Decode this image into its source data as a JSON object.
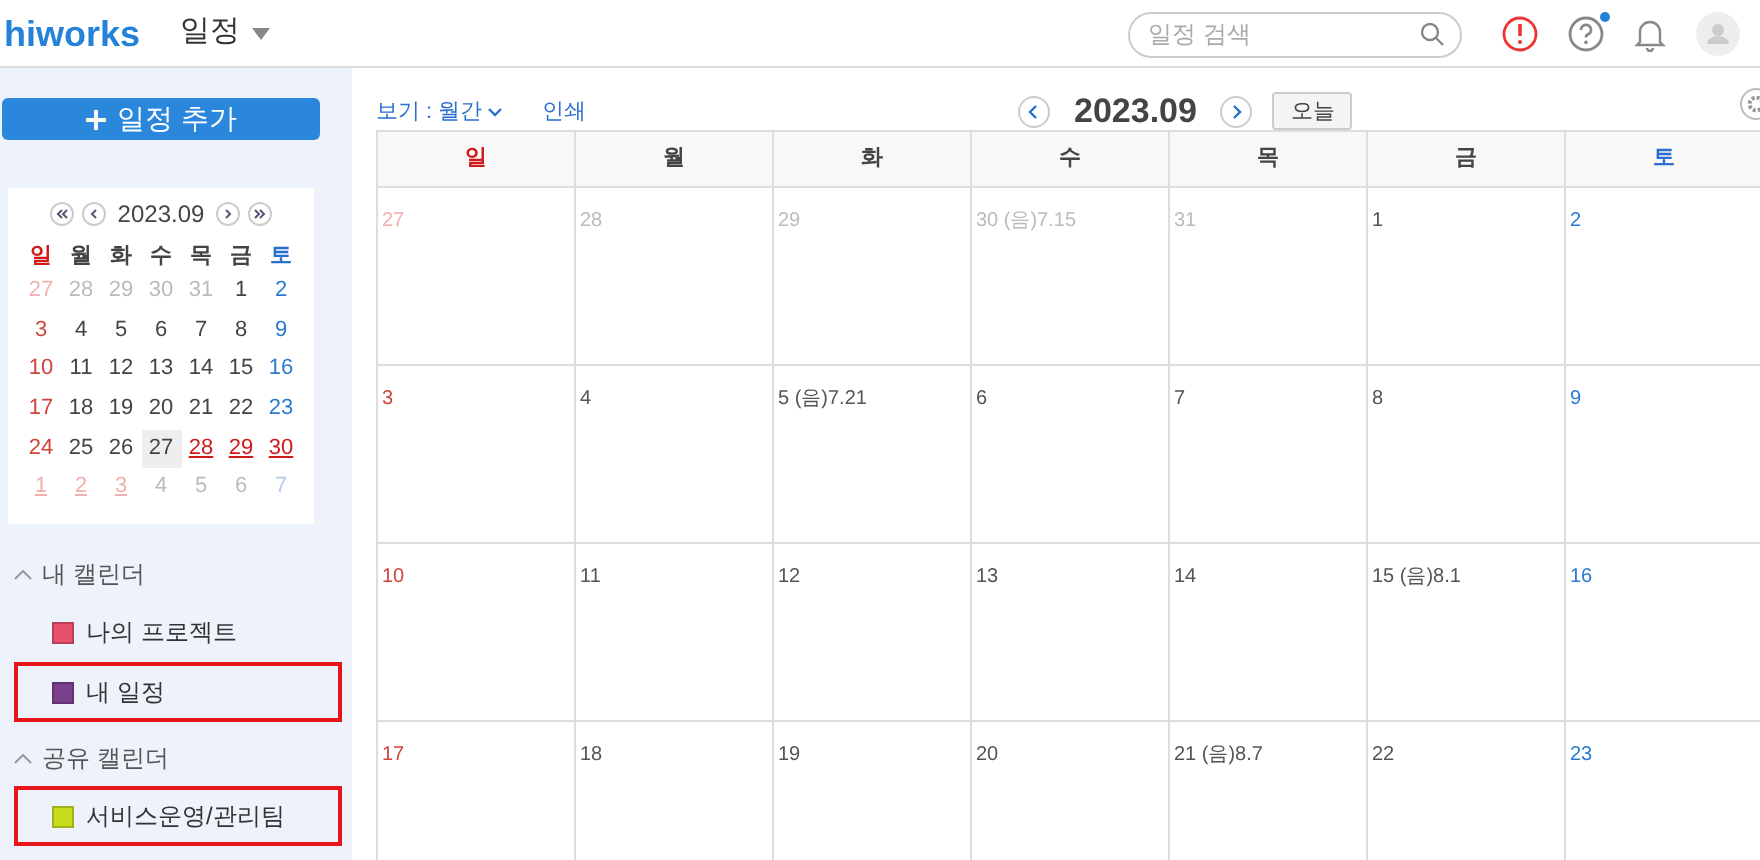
{
  "header": {
    "logo": "hiworks",
    "app_menu": "일정",
    "search": {
      "placeholder": "일정 검색"
    },
    "help_has_notice": true
  },
  "sidebar": {
    "add_button": "일정 추가",
    "mini_calendar": {
      "title": "2023.09",
      "weekdays": [
        "일",
        "월",
        "화",
        "수",
        "목",
        "금",
        "토"
      ],
      "weeks": [
        [
          {
            "day": "27",
            "other_month": true,
            "holiday": false,
            "selected": false
          },
          {
            "day": "28",
            "other_month": true,
            "holiday": false,
            "selected": false
          },
          {
            "day": "29",
            "other_month": true,
            "holiday": false,
            "selected": false
          },
          {
            "day": "30",
            "other_month": true,
            "holiday": false,
            "selected": false
          },
          {
            "day": "31",
            "other_month": true,
            "holiday": false,
            "selected": false
          },
          {
            "day": "1",
            "other_month": false,
            "holiday": false,
            "selected": false
          },
          {
            "day": "2",
            "other_month": false,
            "holiday": false,
            "selected": false
          }
        ],
        [
          {
            "day": "3",
            "other_month": false,
            "holiday": false,
            "selected": false
          },
          {
            "day": "4",
            "other_month": false,
            "holiday": false,
            "selected": false
          },
          {
            "day": "5",
            "other_month": false,
            "holiday": false,
            "selected": false
          },
          {
            "day": "6",
            "other_month": false,
            "holiday": false,
            "selected": false
          },
          {
            "day": "7",
            "other_month": false,
            "holiday": false,
            "selected": false
          },
          {
            "day": "8",
            "other_month": false,
            "holiday": false,
            "selected": false
          },
          {
            "day": "9",
            "other_month": false,
            "holiday": false,
            "selected": false
          }
        ],
        [
          {
            "day": "10",
            "other_month": false,
            "holiday": false,
            "selected": false
          },
          {
            "day": "11",
            "other_month": false,
            "holiday": false,
            "selected": false
          },
          {
            "day": "12",
            "other_month": false,
            "holiday": false,
            "selected": false
          },
          {
            "day": "13",
            "other_month": false,
            "holiday": false,
            "selected": false
          },
          {
            "day": "14",
            "other_month": false,
            "holiday": false,
            "selected": false
          },
          {
            "day": "15",
            "other_month": false,
            "holiday": false,
            "selected": false
          },
          {
            "day": "16",
            "other_month": false,
            "holiday": false,
            "selected": false
          }
        ],
        [
          {
            "day": "17",
            "other_month": false,
            "holiday": false,
            "selected": false
          },
          {
            "day": "18",
            "other_month": false,
            "holiday": false,
            "selected": false
          },
          {
            "day": "19",
            "other_month": false,
            "holiday": false,
            "selected": false
          },
          {
            "day": "20",
            "other_month": false,
            "holiday": false,
            "selected": false
          },
          {
            "day": "21",
            "other_month": false,
            "holiday": false,
            "selected": false
          },
          {
            "day": "22",
            "other_month": false,
            "holiday": false,
            "selected": false
          },
          {
            "day": "23",
            "other_month": false,
            "holiday": false,
            "selected": false
          }
        ],
        [
          {
            "day": "24",
            "other_month": false,
            "holiday": false,
            "selected": false
          },
          {
            "day": "25",
            "other_month": false,
            "holiday": false,
            "selected": false
          },
          {
            "day": "26",
            "other_month": false,
            "holiday": false,
            "selected": false
          },
          {
            "day": "27",
            "other_month": false,
            "holiday": false,
            "selected": true
          },
          {
            "day": "28",
            "other_month": false,
            "holiday": true,
            "selected": false
          },
          {
            "day": "29",
            "other_month": false,
            "holiday": true,
            "selected": false
          },
          {
            "day": "30",
            "other_month": false,
            "holiday": true,
            "selected": false
          }
        ],
        [
          {
            "day": "1",
            "other_month": true,
            "holiday": true,
            "selected": false
          },
          {
            "day": "2",
            "other_month": true,
            "holiday": true,
            "selected": false
          },
          {
            "day": "3",
            "other_month": true,
            "holiday": true,
            "selected": false
          },
          {
            "day": "4",
            "other_month": true,
            "holiday": false,
            "selected": false
          },
          {
            "day": "5",
            "other_month": true,
            "holiday": false,
            "selected": false
          },
          {
            "day": "6",
            "other_month": true,
            "holiday": false,
            "selected": false
          },
          {
            "day": "7",
            "other_month": true,
            "holiday": false,
            "selected": false
          }
        ]
      ]
    },
    "sections": [
      {
        "title": "내 캘린더",
        "expanded": true,
        "calendars": [
          {
            "name": "나의 프로젝트",
            "color": "#e8506e",
            "highlighted": false
          },
          {
            "name": "내 일정",
            "color": "#7b3f8c",
            "highlighted": true
          }
        ]
      },
      {
        "title": "공유 캘린더",
        "expanded": true,
        "calendars": [
          {
            "name": "서비스운영/관리팀",
            "color": "#c8dc1e",
            "highlighted": true
          }
        ]
      }
    ]
  },
  "toolbar": {
    "view": "보기 : 월간",
    "print": "인쇄",
    "title": "2023.09",
    "today": "오늘"
  },
  "calendar": {
    "weekdays": [
      "일",
      "월",
      "화",
      "수",
      "목",
      "금",
      "토"
    ],
    "weeks": [
      [
        {
          "day": "27",
          "other_month": true
        },
        {
          "day": "28",
          "other_month": true
        },
        {
          "day": "29",
          "other_month": true
        },
        {
          "day": "30 (음)7.15",
          "other_month": true
        },
        {
          "day": "31",
          "other_month": true
        },
        {
          "day": "1",
          "other_month": false
        },
        {
          "day": "2",
          "other_month": false
        }
      ],
      [
        {
          "day": "3",
          "other_month": false
        },
        {
          "day": "4",
          "other_month": false
        },
        {
          "day": "5 (음)7.21",
          "other_month": false
        },
        {
          "day": "6",
          "other_month": false
        },
        {
          "day": "7",
          "other_month": false
        },
        {
          "day": "8",
          "other_month": false
        },
        {
          "day": "9",
          "other_month": false
        }
      ],
      [
        {
          "day": "10",
          "other_month": false
        },
        {
          "day": "11",
          "other_month": false
        },
        {
          "day": "12",
          "other_month": false
        },
        {
          "day": "13",
          "other_month": false
        },
        {
          "day": "14",
          "other_month": false
        },
        {
          "day": "15 (음)8.1",
          "other_month": false
        },
        {
          "day": "16",
          "other_month": false
        }
      ],
      [
        {
          "day": "17",
          "other_month": false
        },
        {
          "day": "18",
          "other_month": false
        },
        {
          "day": "19",
          "other_month": false
        },
        {
          "day": "20",
          "other_month": false
        },
        {
          "day": "21 (음)8.7",
          "other_month": false
        },
        {
          "day": "22",
          "other_month": false
        },
        {
          "day": "23",
          "other_month": false
        }
      ]
    ]
  }
}
